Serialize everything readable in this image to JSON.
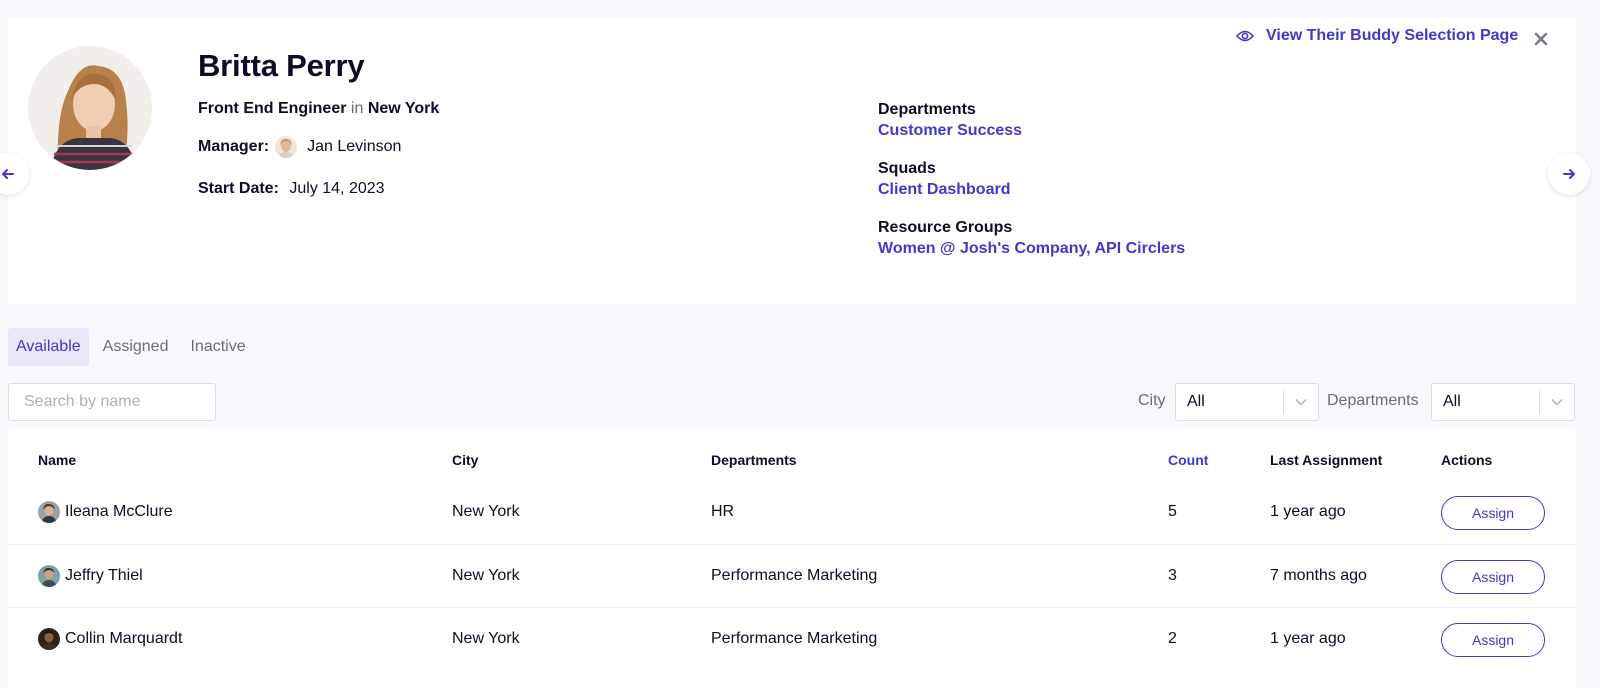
{
  "profile": {
    "name": "Britta Perry",
    "role": "Front End Engineer",
    "role_connector": "in",
    "location": "New York",
    "manager_label": "Manager:",
    "manager_name": "Jan Levinson",
    "start_label": "Start Date:",
    "start_date": "July 14, 2023",
    "view_link": "View Their Buddy Selection Page",
    "meta": {
      "departments_label": "Departments",
      "departments_value": "Customer Success",
      "squads_label": "Squads",
      "squads_value": "Client Dashboard",
      "resource_groups_label": "Resource Groups",
      "resource_groups_value": "Women @ Josh's Company, API Circlers"
    }
  },
  "tabs": [
    "Available",
    "Assigned",
    "Inactive"
  ],
  "search": {
    "placeholder": "Search by name"
  },
  "filters": {
    "city_label": "City",
    "city_value": "All",
    "departments_label": "Departments",
    "departments_value": "All"
  },
  "table": {
    "headers": {
      "name": "Name",
      "city": "City",
      "departments": "Departments",
      "count": "Count",
      "last_assignment": "Last Assignment",
      "actions": "Actions"
    },
    "rows": [
      {
        "name": "Ileana McClure",
        "city": "New York",
        "department": "HR",
        "count": "5",
        "last_assignment": "1 year ago",
        "action": "Assign"
      },
      {
        "name": "Jeffry Thiel",
        "city": "New York",
        "department": "Performance Marketing",
        "count": "3",
        "last_assignment": "7 months ago",
        "action": "Assign"
      },
      {
        "name": "Collin Marquardt",
        "city": "New York",
        "department": "Performance Marketing",
        "count": "2",
        "last_assignment": "1 year ago",
        "action": "Assign"
      }
    ]
  },
  "icons": {
    "prev": "arrow-left-icon",
    "next": "arrow-right-icon",
    "view": "eye-icon",
    "close": "close-icon",
    "dropdown": "chevron-down-icon"
  },
  "colors": {
    "accent": "#4338ca",
    "text": "#0d0d26",
    "muted": "#6b6b80",
    "background": "#f8f9fc",
    "active_tab_bg": "#e8e8fb"
  }
}
